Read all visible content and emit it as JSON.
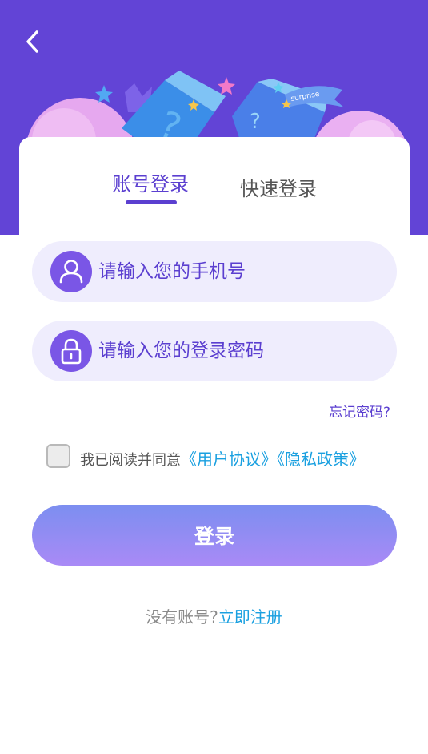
{
  "tabs": [
    {
      "label": "账号登录",
      "active": true
    },
    {
      "label": "快速登录",
      "active": false
    }
  ],
  "form": {
    "phone_placeholder": "请输入您的手机号",
    "password_placeholder": "请输入您的登录密码",
    "phone_value": "",
    "password_value": ""
  },
  "forgot_label": "忘记密码?",
  "agreement": {
    "prefix": "我已阅读并同意",
    "user_agreement": "《用户协议》",
    "privacy_policy": "《隐私政策》",
    "checked": false
  },
  "login_label": "登录",
  "signup": {
    "prompt": "没有账号?",
    "link": "立即注册"
  },
  "hero": {
    "banner_text": "surprise"
  },
  "colors": {
    "primary": "#6244d6",
    "accent_text": "#5b3fd0",
    "field_bg": "#efedfd",
    "link": "#1aa0e0",
    "button_gradient_top": "#7c8ef0",
    "button_gradient_bottom": "#a98af6"
  },
  "icons": {
    "back": "chevron-left-icon",
    "phone_field": "user-icon",
    "password_field": "lock-icon"
  }
}
